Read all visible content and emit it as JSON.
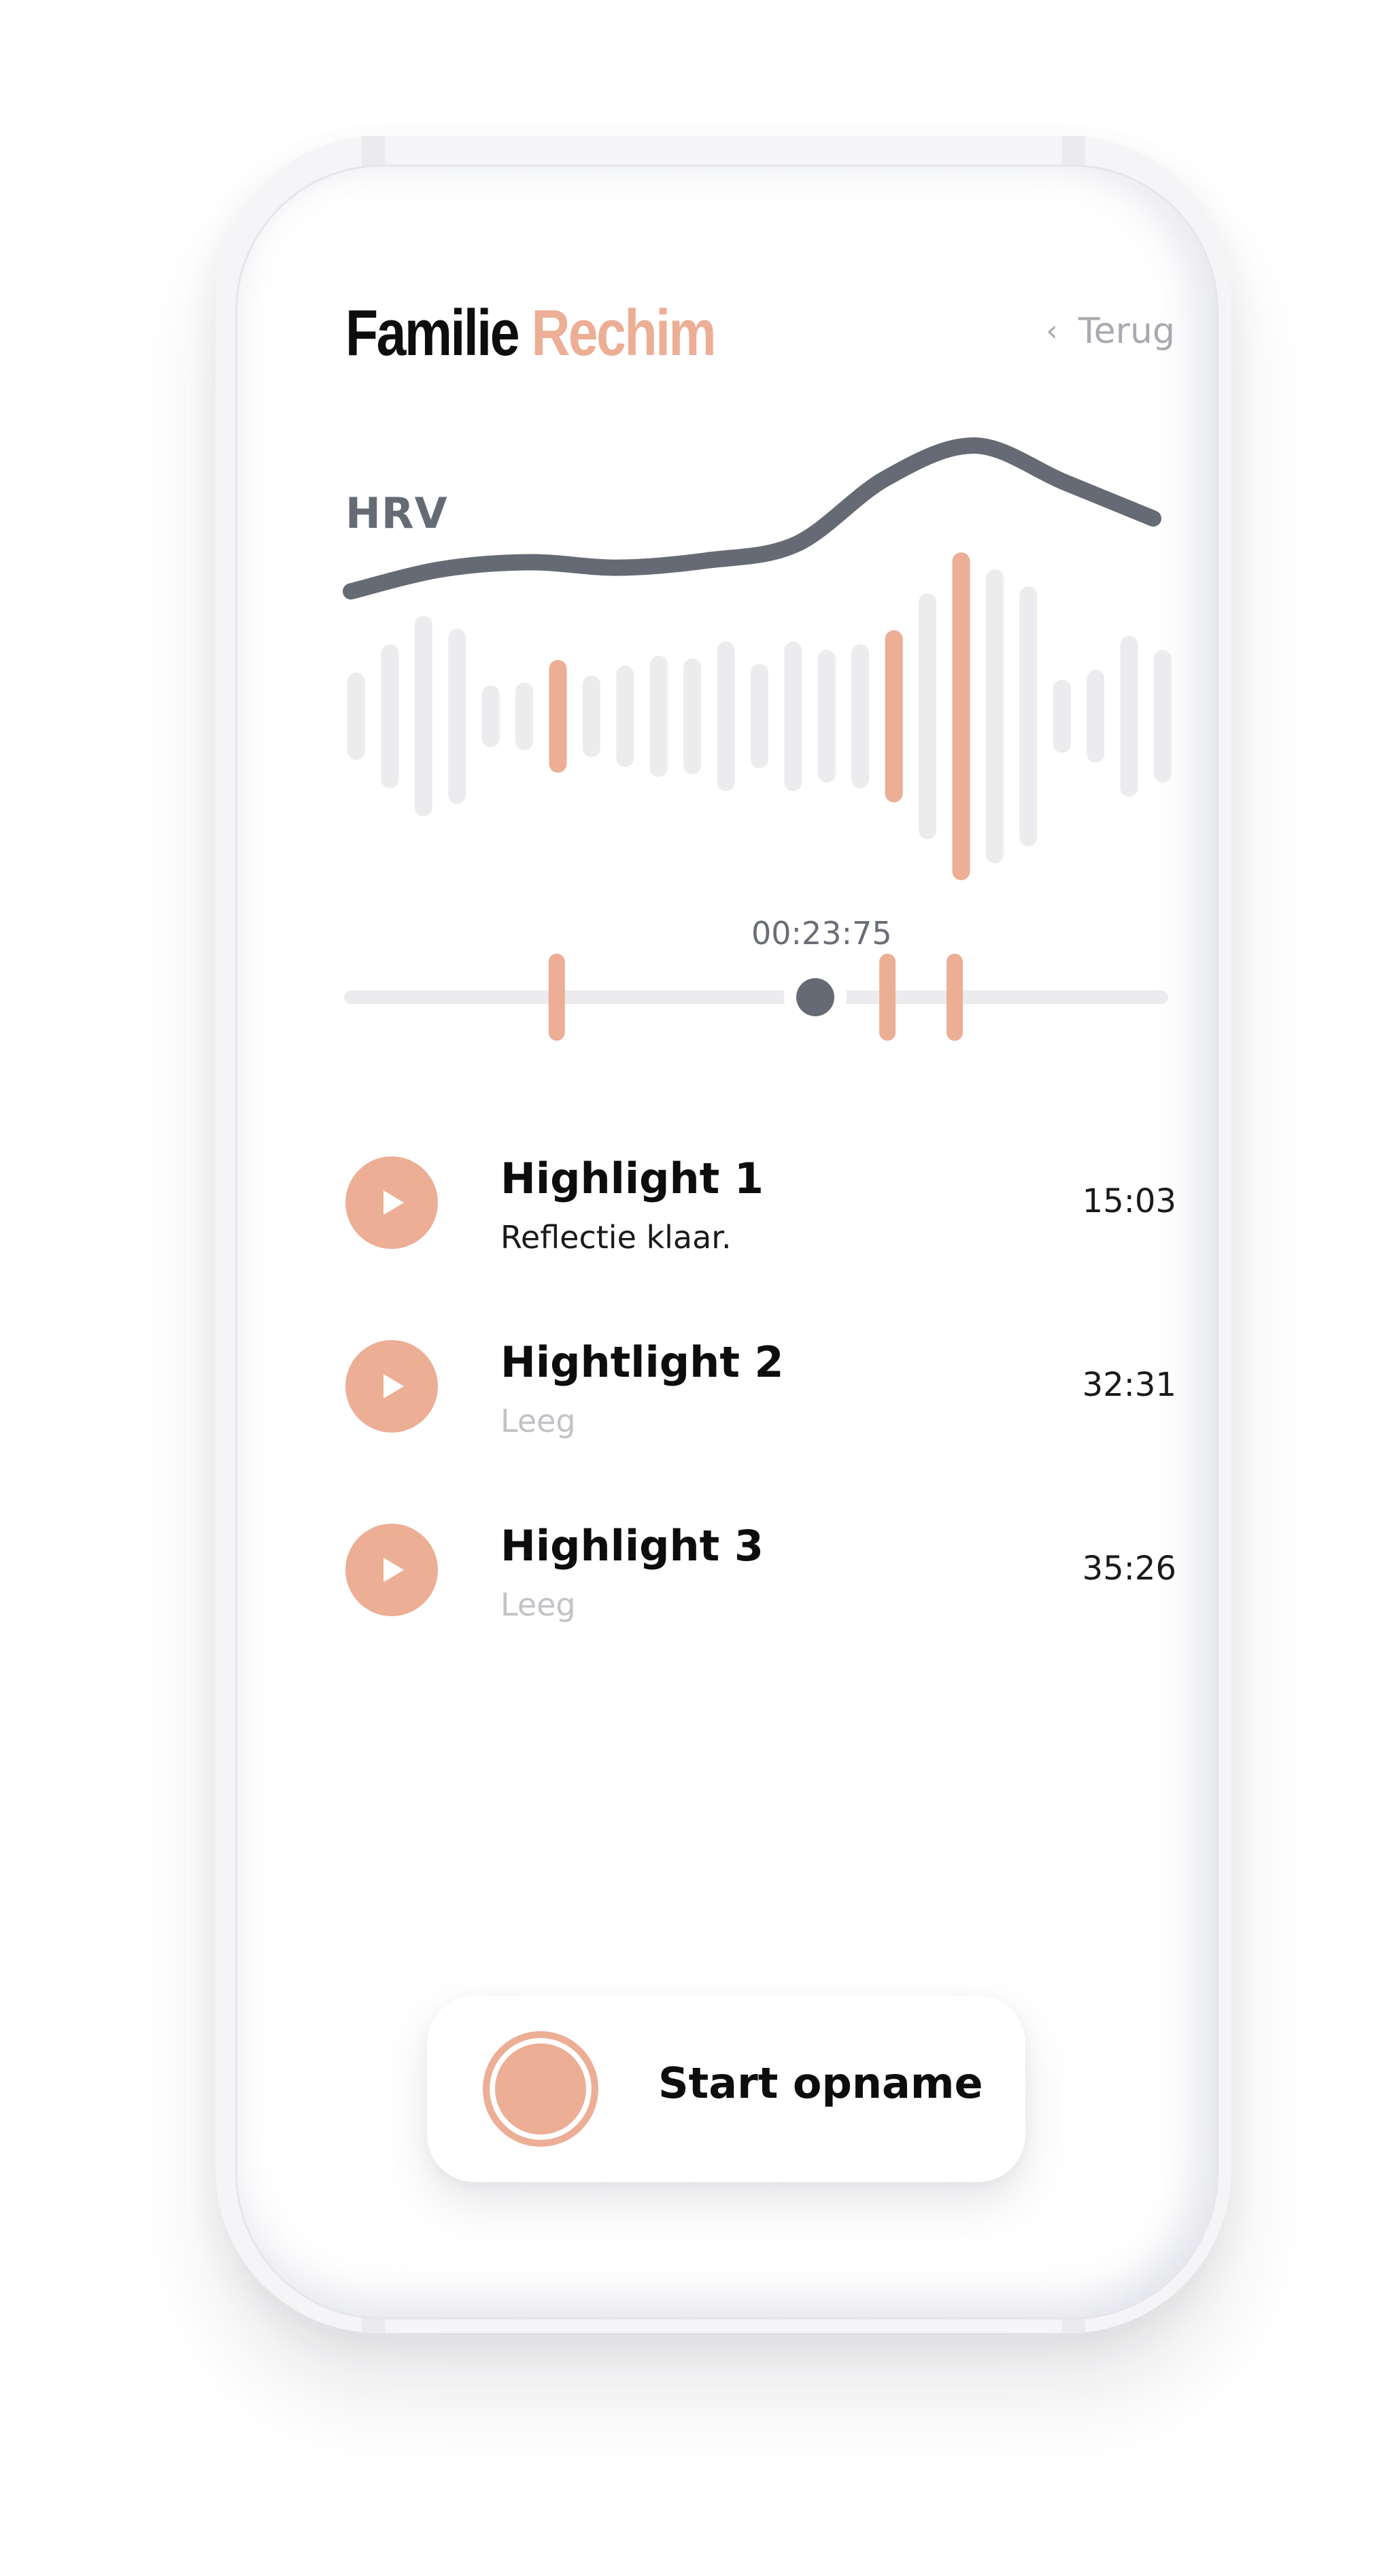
{
  "header": {
    "title_main": "Familie",
    "title_accent": "Rechim",
    "back_label": "Terug",
    "back_icon": "chevron-left-icon"
  },
  "chart_data": {
    "type": "line",
    "label": "HRV",
    "series": [
      {
        "values": [
          0.2,
          0.32,
          0.36,
          0.33,
          0.37,
          0.46,
          0.82,
          1.0,
          0.8,
          0.6
        ]
      }
    ],
    "waveform_bars": [
      {
        "level": 0.15,
        "highlight": false
      },
      {
        "level": 0.35,
        "highlight": false
      },
      {
        "level": 0.55,
        "highlight": false
      },
      {
        "level": 0.46,
        "highlight": false
      },
      {
        "level": 0.06,
        "highlight": false
      },
      {
        "level": 0.08,
        "highlight": false
      },
      {
        "level": 0.24,
        "highlight": true
      },
      {
        "level": 0.13,
        "highlight": false
      },
      {
        "level": 0.2,
        "highlight": false
      },
      {
        "level": 0.27,
        "highlight": false
      },
      {
        "level": 0.25,
        "highlight": false
      },
      {
        "level": 0.37,
        "highlight": false
      },
      {
        "level": 0.21,
        "highlight": false
      },
      {
        "level": 0.37,
        "highlight": false
      },
      {
        "level": 0.31,
        "highlight": false
      },
      {
        "level": 0.35,
        "highlight": false
      },
      {
        "level": 0.45,
        "highlight": true
      },
      {
        "level": 0.71,
        "highlight": false
      },
      {
        "level": 1.0,
        "highlight": true
      },
      {
        "level": 0.88,
        "highlight": false
      },
      {
        "level": 0.76,
        "highlight": false
      },
      {
        "level": 0.1,
        "highlight": false
      },
      {
        "level": 0.17,
        "highlight": false
      },
      {
        "level": 0.41,
        "highlight": false
      },
      {
        "level": 0.31,
        "highlight": false
      }
    ],
    "progress": 0.573,
    "highlight_markers": [
      0.254,
      0.662,
      0.745
    ]
  },
  "player": {
    "timestamp": "00:23:75"
  },
  "highlights": [
    {
      "title": "Highlight 1",
      "subtitle": "Reflectie klaar.",
      "time": "15:03",
      "empty": false
    },
    {
      "title": "Hightlight 2",
      "subtitle": "Leeg",
      "time": "32:31",
      "empty": true
    },
    {
      "title": "Highlight 3",
      "subtitle": "Leeg",
      "time": "35:26",
      "empty": true
    }
  ],
  "record": {
    "label": "Start opname",
    "icon": "record-icon"
  },
  "colors": {
    "accent": "#ecae95",
    "curve": "#666a74",
    "bar_inactive": "#ececee",
    "track": "#ececee"
  }
}
